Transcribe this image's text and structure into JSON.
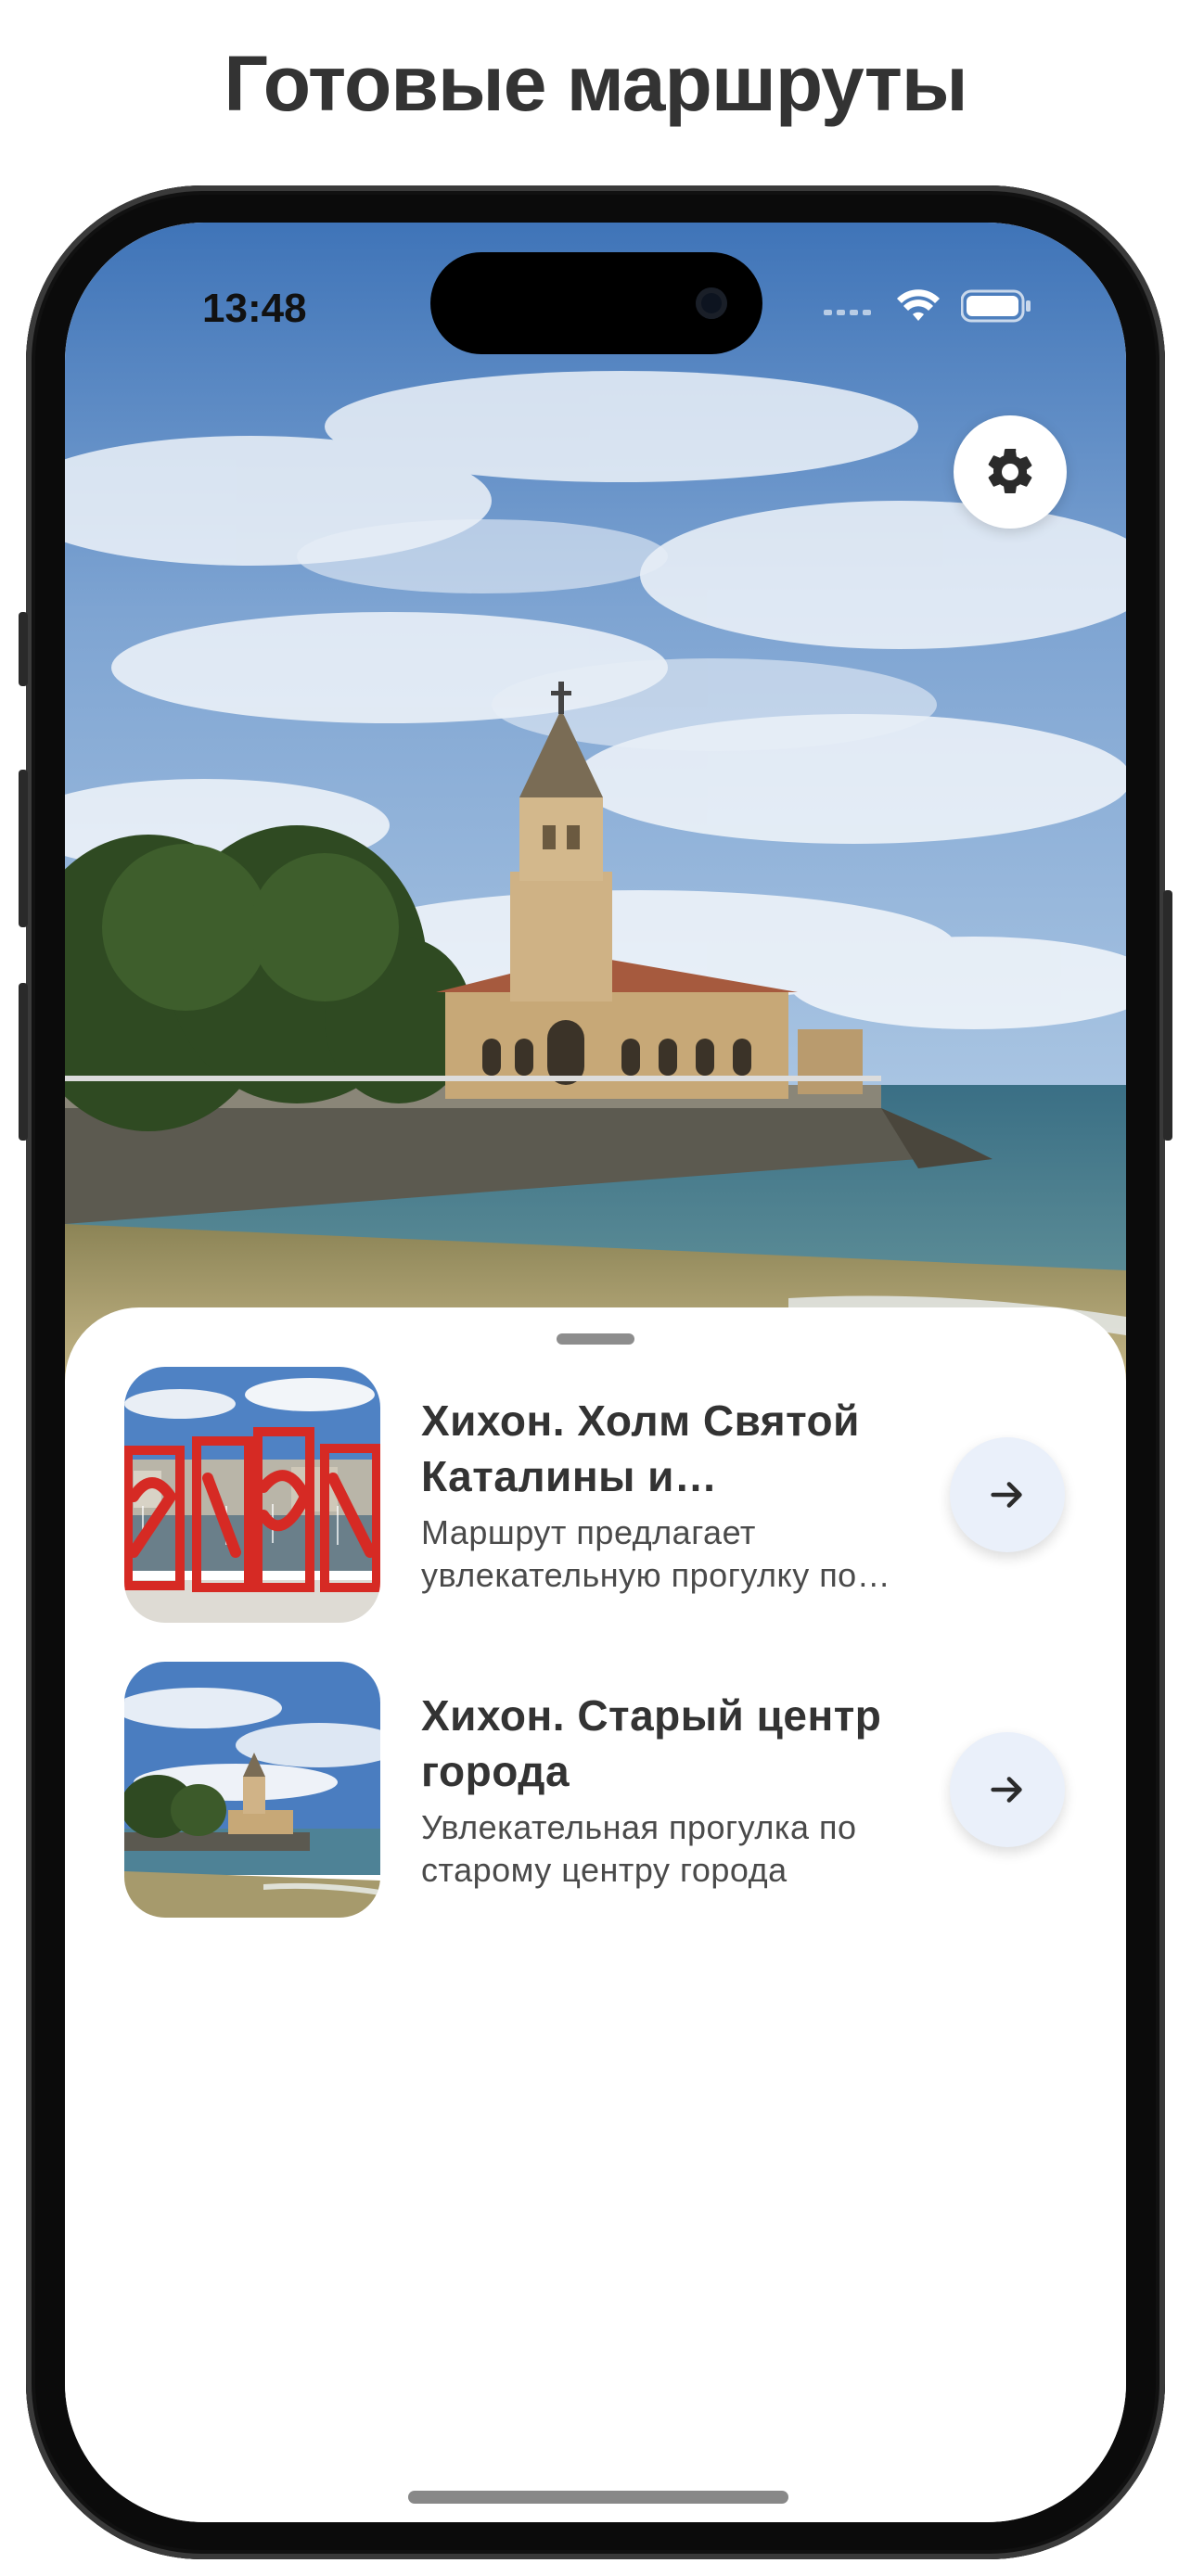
{
  "headline": "Готовые маршруты",
  "status_bar": {
    "time": "13:48",
    "icons": [
      "signal-icon",
      "wifi-icon",
      "battery-icon"
    ]
  },
  "settings": {
    "icon": "gear-icon"
  },
  "routes": [
    {
      "title": "Хихон. Холм Святой Каталины и окрестности",
      "description": "Маршрут предлагает увлекательную прогулку по холму Святой Каталины",
      "thumbnail": "gijon-letters-sculpture",
      "action_icon": "arrow-right-icon"
    },
    {
      "title": "Хихон. Старый центр города",
      "description": "Увлекательная прогулка по старому центру города",
      "thumbnail": "church-by-the-sea",
      "action_icon": "arrow-right-icon"
    }
  ],
  "colors": {
    "headline_text": "#333333",
    "card_title": "#333333",
    "card_desc": "#4a4a4a",
    "arrow_button_bg": "#eaf0fa",
    "sheet_bg": "#ffffff"
  }
}
